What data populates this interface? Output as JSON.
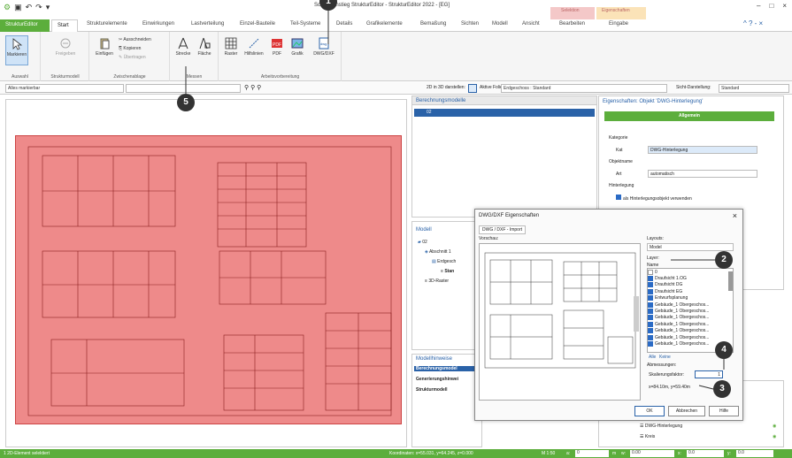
{
  "window": {
    "title": "Schnelleinstieg StrukturEditor - StrukturEditor 2022 - [EG]",
    "controls": [
      "–",
      "□",
      "×"
    ]
  },
  "tabs": {
    "file": "StrukturEditor",
    "start": "Start",
    "items": [
      "Strukturelemente",
      "Einwirkungen",
      "Lastverteilung",
      "Einzel-Bauteile",
      "Teil-Systeme",
      "Details",
      "Grafikelemente",
      "Bemaßung",
      "Sichten",
      "Modell",
      "Ansicht"
    ],
    "ctx_selection": "Selektion",
    "ctx_properties": "Eigenschaften",
    "ctx_edit": "Bearbeiten",
    "ctx_input": "Eingabe"
  },
  "ribbon": {
    "auswahl": {
      "label": "Auswahl",
      "markieren": "Markieren"
    },
    "strukturmodell": {
      "label": "Strukturmodell",
      "freigeben": "Freigeben"
    },
    "zwischenablage": {
      "label": "Zwischenablage",
      "einfuegen": "Einfügen",
      "ausschneiden": "Ausschneiden",
      "kopieren": "Kopieren",
      "uebertragen": "Übertragen"
    },
    "messen": {
      "label": "Messen",
      "strecke": "Strecke",
      "flaeche": "Fläche"
    },
    "arbeitsvorbereitung": {
      "label": "Arbeitsvorbereitung",
      "raster": "Raster",
      "hilfslinien": "Hilfslinien",
      "pdf": "PDF",
      "grafik": "Grafik",
      "dwg": "DWG/DXF"
    }
  },
  "toolbar": {
    "filter": "Alles markierbar",
    "display_3d": "2D in 3D darstellen:",
    "active_layer_label": "Aktive Folie:",
    "active_layer": "Erdgeschoss : Standard",
    "view_label": "Sicht-Darstellung:",
    "view_value": "Standard"
  },
  "panels": {
    "berechnungsmodelle": {
      "title": "Berechnungsmodelle",
      "item": "02"
    },
    "modell": {
      "title": "Modell",
      "items": [
        "02",
        "Abschnitt 1",
        "Erdgesch",
        "Stan",
        "3D-Raster"
      ]
    },
    "modellhinweise": {
      "title": "Modellhinweise",
      "items": [
        "Berechnungsmodel",
        "Generierungshinwei",
        "Strukturmodell"
      ]
    },
    "layers": {
      "items": [
        "DWG-Hinterlegung",
        "Kreis"
      ]
    }
  },
  "properties": {
    "title": "Eigenschaften: Objekt 'DWG-Hinterlegung'",
    "section": "Allgemein",
    "kategorie": "Kategorie",
    "kat_label": "Kat",
    "kat_value": "DWG-Hinterlegung",
    "objektname": "Objektname",
    "art_label": "Art",
    "art_value": "automatisch",
    "hinterlegung": "Hinterlegung",
    "checkbox": "als Hinterlegungsobjekt verwenden"
  },
  "dialog": {
    "title": "DWG/DXF Eigenschaften",
    "tab": "DWG / DXF - Import",
    "preview_label": "Vorschau:",
    "layouts_label": "Layouts:",
    "layouts_value": "Model",
    "layer_label": "Layer:",
    "name_header": "Name",
    "layers": [
      {
        "name": "0",
        "checked": false
      },
      {
        "name": "Draufsicht 1.OG",
        "checked": true
      },
      {
        "name": "Draufsicht DG",
        "checked": true
      },
      {
        "name": "Draufsicht EG",
        "checked": true
      },
      {
        "name": "Entwurfsplanung",
        "checked": true
      },
      {
        "name": "Gebäude_1 Obergeschos...",
        "checked": true
      },
      {
        "name": "Gebäude_1 Obergeschos...",
        "checked": true
      },
      {
        "name": "Gebäude_1 Obergeschos...",
        "checked": true
      },
      {
        "name": "Gebäude_1 Obergeschos...",
        "checked": true
      },
      {
        "name": "Gebäude_1 Obergeschos...",
        "checked": true
      },
      {
        "name": "Gebäude_1 Obergeschos...",
        "checked": true
      },
      {
        "name": "Gebäude_1 Obergeschos...",
        "checked": true
      }
    ],
    "all": "Alle",
    "none": "Keine",
    "dimensions_label": "Abmessungen:",
    "scale_label": "Skalierungsfaktor:",
    "scale_value": "1",
    "dims_value": "x=84.10m, y=59.40m",
    "ok": "OK",
    "cancel": "Abbrechen",
    "help": "Hilfe"
  },
  "callouts": [
    "1",
    "2",
    "3",
    "4",
    "5"
  ],
  "statusbar": {
    "left": "1 2D-Element selektiert",
    "coords": "Koordinaten: x=55.031, y=64.245, z=0.000",
    "scale": "M 1:50",
    "a_label": "a:",
    "a_val": "0",
    "m_label": "m",
    "w_label": "w:",
    "w_val": "0.00",
    "dx_label": "x:",
    "dx_val": "0.0",
    "dy_label": "y:",
    "dy_val": "0.0"
  },
  "colors": {
    "accent": "#5cae3c",
    "selection": "#ee8a8a",
    "ctx_red": "#f4c8c8",
    "ctx_orange": "#fbe3b8"
  }
}
